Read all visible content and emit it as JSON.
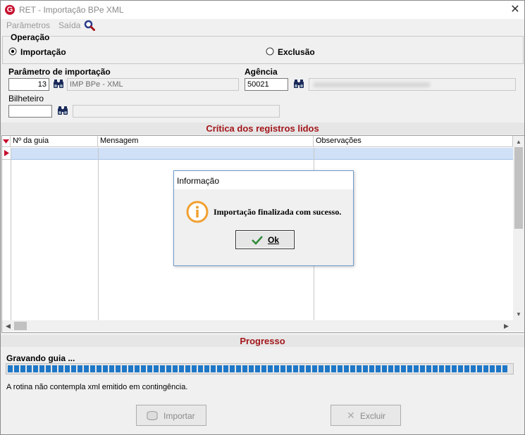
{
  "window": {
    "title": "RET - Importação BPe XML",
    "app_icon_letter": "G"
  },
  "menu": {
    "items": [
      "Parâmetros",
      "Saída"
    ]
  },
  "operation": {
    "group_label": "Operação",
    "options": [
      {
        "label": "Importação",
        "selected": true
      },
      {
        "label": "Exclusão",
        "selected": false
      }
    ]
  },
  "params": {
    "param_label": "Parâmetro de importação",
    "param_code": "13",
    "param_desc": "IMP BPe - XML",
    "agencia_label": "Agência",
    "agencia_code": "50021",
    "bilheteiro_label": "Bilheteiro",
    "bilheteiro_code": ""
  },
  "critica": {
    "title": "Crítica dos registros lidos",
    "columns": [
      "Nº da guia",
      "Mensagem",
      "Observações"
    ]
  },
  "dialog": {
    "title": "Informação",
    "message": "Importação finalizada com sucesso.",
    "ok_label": "Ok"
  },
  "progress": {
    "title": "Progresso",
    "status": "Gravando guia ...",
    "value": 1.0,
    "note": "A rotina não contempla xml emitido em contingência."
  },
  "buttons": {
    "importar": "Importar",
    "excluir": "Excluir"
  },
  "colors": {
    "section_title": "#a3151a",
    "progress": "#1e77c7",
    "selection_row": "#cfe0f7"
  }
}
